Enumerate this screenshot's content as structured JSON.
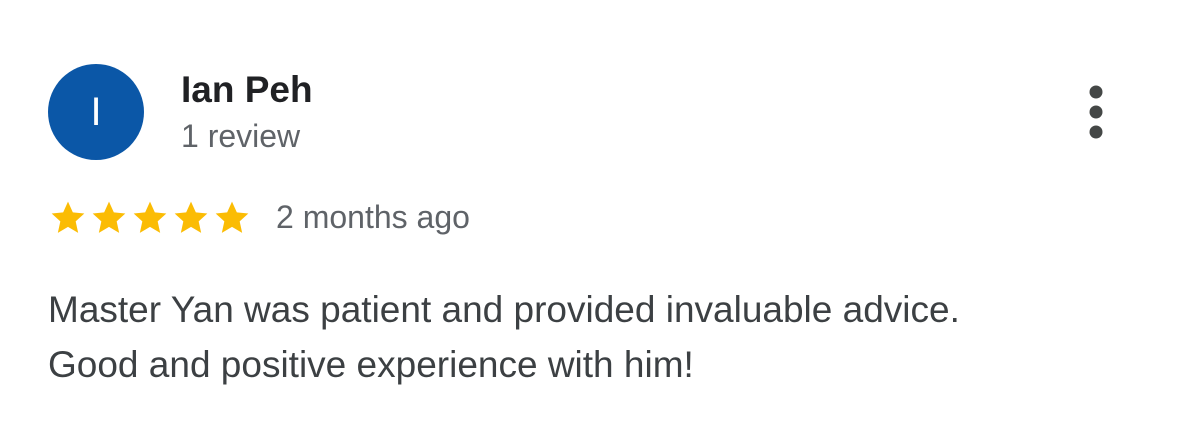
{
  "review": {
    "avatar_initial": "I",
    "avatar_color": "#0b57a7",
    "reviewer_name": "Ian Peh",
    "review_count": "1 review",
    "menu_icon": "more-vert-icon",
    "rating": 5,
    "rating_max": 5,
    "star_icon": "star-icon",
    "star_color": "#fbbc04",
    "time_ago": "2 months ago",
    "text_lines": [
      "Master Yan was patient and provided invaluable advice.",
      "Good and positive experience with him!"
    ]
  }
}
